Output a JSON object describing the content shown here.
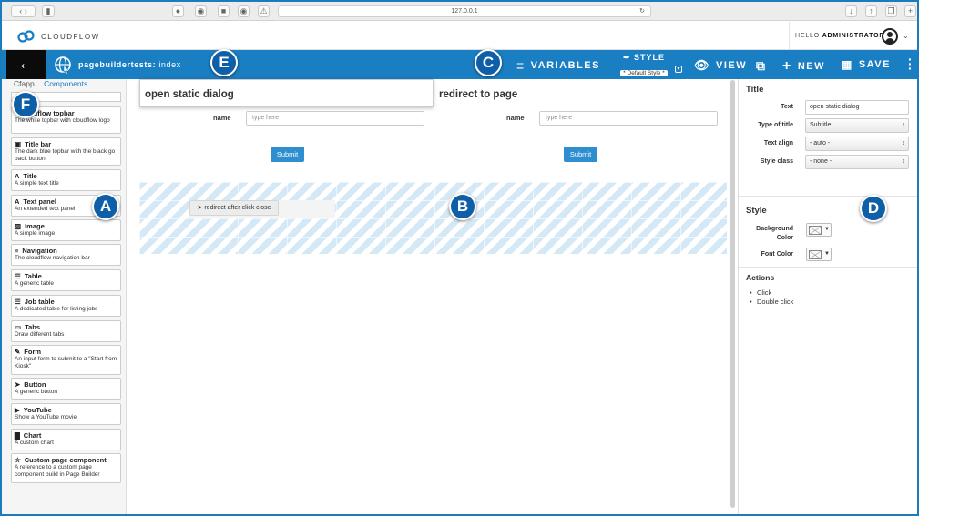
{
  "browser": {
    "url": "127.0.0.1"
  },
  "topbar": {
    "brand": "CLOUDFLOW",
    "hello": "HELLO ",
    "user": "ADMINISTRATOR"
  },
  "navbar": {
    "back": "←",
    "page_name": "pagebuildertests:",
    "page_suffix": " index",
    "variables": "VARIABLES",
    "style_label": "STYLE",
    "style_value": "* Default Style *",
    "view": "VIEW",
    "new": "NEW",
    "save": "SAVE",
    "accent": "#1a7ec2"
  },
  "markers": {
    "a": "A",
    "b": "B",
    "c": "C",
    "d": "D",
    "e": "E",
    "f": "F"
  },
  "left": {
    "tab_cfapp": "Cfapp",
    "tab_components": "Components",
    "components": [
      {
        "icon": "topbar-icon",
        "glyph": "",
        "title": "Cloudflow topbar",
        "desc": "The white topbar with cloudflow logo"
      },
      {
        "icon": "titlebar-icon",
        "glyph": "▣",
        "title": "Title bar",
        "desc": "The dark blue topbar with the black go back button"
      },
      {
        "icon": "title-icon",
        "glyph": "A",
        "title": "Title",
        "desc": "A simple text title"
      },
      {
        "icon": "text-panel-icon",
        "glyph": "A",
        "title": "Text panel",
        "desc": "An extended text panel"
      },
      {
        "icon": "image-icon",
        "glyph": "▨",
        "title": "Image",
        "desc": "A simple image"
      },
      {
        "icon": "navigation-icon",
        "glyph": "≡",
        "title": "Navigation",
        "desc": "The cloudflow navigation bar"
      },
      {
        "icon": "table-icon",
        "glyph": "☰",
        "title": "Table",
        "desc": "A generic table"
      },
      {
        "icon": "job-table-icon",
        "glyph": "☰",
        "title": "Job table",
        "desc": "A dedicated table for listing jobs"
      },
      {
        "icon": "tabs-icon",
        "glyph": "▭",
        "title": "Tabs",
        "desc": "Draw different tabs"
      },
      {
        "icon": "form-icon",
        "glyph": "✎",
        "title": "Form",
        "desc": "An input form to submit to a \"Start from Kiosk\""
      },
      {
        "icon": "button-icon",
        "glyph": "➤",
        "title": "Button",
        "desc": "A generic button"
      },
      {
        "icon": "youtube-icon",
        "glyph": "▶",
        "title": "YouTube",
        "desc": "Show a YouTube movie"
      },
      {
        "icon": "chart-icon",
        "glyph": "▇",
        "title": "Chart",
        "desc": "A custom chart"
      },
      {
        "icon": "star-icon",
        "glyph": "☆",
        "title": "Custom page component",
        "desc": "A reference to a custom page component build in Page Builder"
      }
    ]
  },
  "canvas": {
    "title_left": "open static dialog",
    "title_right": "redirect to page",
    "name_label_left": "name",
    "name_label_right": "name",
    "placeholder_left": "type here",
    "placeholder_right": "type here",
    "submit_left": "Submit",
    "submit_right": "Submit",
    "redirect_button": "redirect after click close"
  },
  "right": {
    "section_title": "Title",
    "text_label": "Text",
    "text_value": "open static dialog",
    "type_label": "Type of title",
    "type_value": "Subtitle",
    "align_label": "Text align",
    "align_value": "- auto -",
    "class_label": "Style class",
    "class_value": "- none -",
    "style_title": "Style",
    "bg_label": "Background Color",
    "font_label": "Font Color",
    "actions_title": "Actions",
    "actions": [
      "Click",
      "Double click"
    ]
  }
}
